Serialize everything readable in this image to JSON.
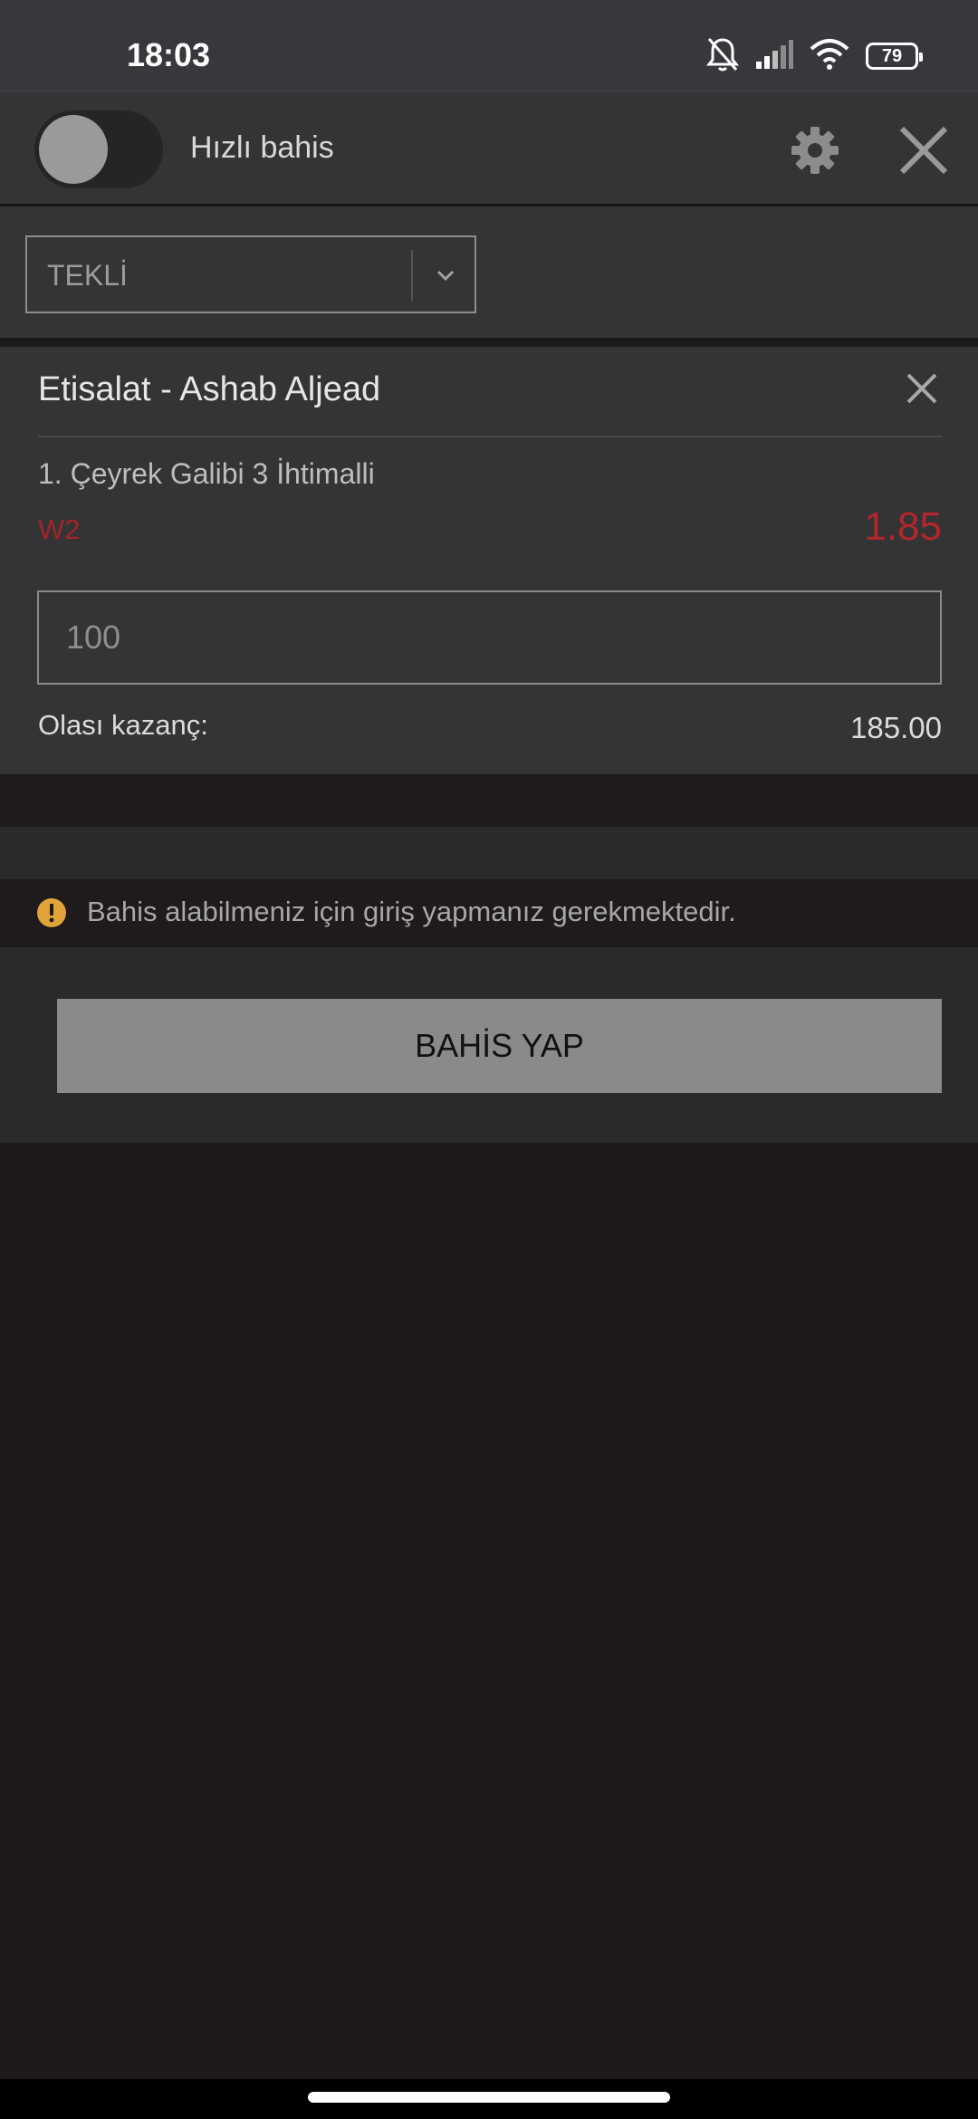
{
  "status_bar": {
    "time": "18:03",
    "battery": "79",
    "icons": [
      "bell-off-icon",
      "signal-icon",
      "wifi-icon",
      "battery-icon"
    ]
  },
  "header": {
    "quick_bet_label": "Hızlı bahis",
    "quick_bet_on": false,
    "icons": [
      "gear-icon",
      "close-icon"
    ]
  },
  "bet_type": {
    "selected": "TEKLİ"
  },
  "bet_slip": {
    "match": "Etisalat - Ashab Aljead",
    "market": "1. Çeyrek Galibi 3 İhtimalli",
    "selection": "W2",
    "odds": "1.85",
    "stake_placeholder": "100",
    "possible_win_label": "Olası kazanç:",
    "possible_win_value": "185.00"
  },
  "notice": {
    "text": "Bahis alabilmeniz için giriş yapmanız gerekmektedir."
  },
  "actions": {
    "place_bet_label": "BAHİS YAP"
  },
  "colors": {
    "odds_red": "#b3262a",
    "warning_amber": "#e0a43a",
    "panel": "#343436",
    "background": "#1e1a1b"
  }
}
